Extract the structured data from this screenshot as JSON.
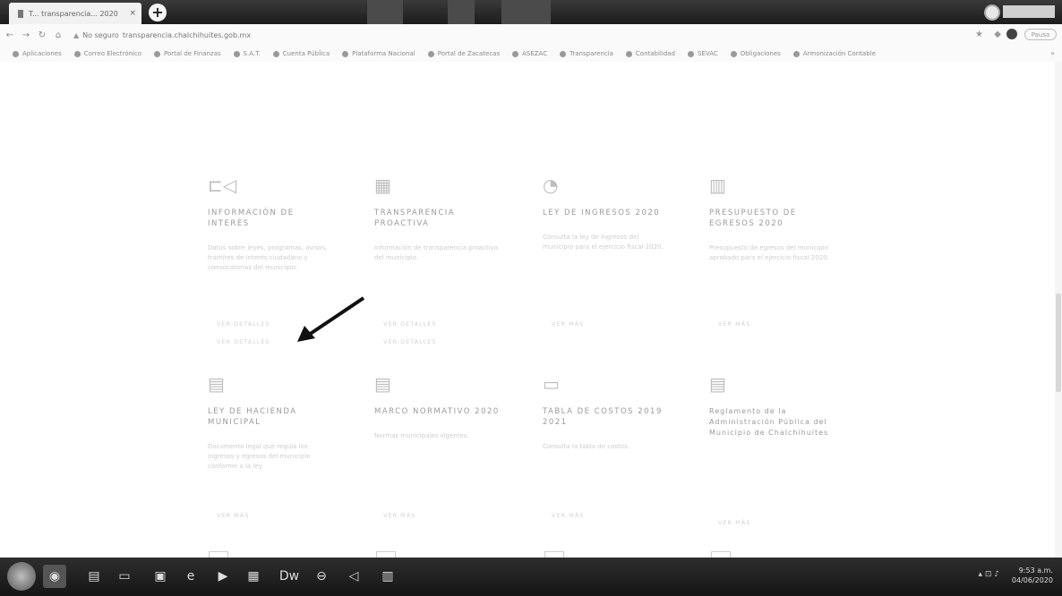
{
  "browser": {
    "tab_title": "T... transparencia... 2020",
    "tab_close": "×",
    "new_tab": "+",
    "url": "transparencia.chalchihuites.gob.mx",
    "secure_label": "No seguro",
    "paused_label": "Pausa",
    "bookmarks_more": "»",
    "bookmarks": [
      "Aplicaciones",
      "Correo Electrónico",
      "Portal de Finanzas",
      "S.A.T.",
      "Cuenta Pública",
      "Plataforma Nacional",
      "Portal de Zacatecas",
      "ASEZAC",
      "Transparencia",
      "Contabilidad",
      "SEVAC",
      "Obligaciones",
      "Armonización Contable"
    ]
  },
  "cards": [
    {
      "icon": "megaphone-icon",
      "title": "INFORMACIÓN DE INTERÉS",
      "desc": "Datos sobre leyes, programas, avisos, trámites de interés ciudadano y convocatorias del municipio.",
      "link": "VER DETALLES",
      "link2": "VER DETALLES"
    },
    {
      "icon": "calendar-icon",
      "title": "TRANSPARENCIA PROACTIVA",
      "desc": "Información de transparencia proactiva del municipio.",
      "link": "VER DETALLES",
      "link2": "VER DETALLES"
    },
    {
      "icon": "pie-chart-icon",
      "title": "LEY DE INGRESOS 2020",
      "desc": "Consulta la ley de ingresos del municipio para el ejercicio fiscal 2020.",
      "link": "VER MÁS",
      "link2": ""
    },
    {
      "icon": "bar-chart-icon",
      "title": "PRESUPUESTO DE EGRESOS 2020",
      "desc": "Presupuesto de egresos del municipio aprobado para el ejercicio fiscal 2020.",
      "link": "VER MÁS",
      "link2": ""
    },
    {
      "icon": "book-icon",
      "title": "LEY DE HACIENDA MUNICIPAL",
      "desc": "Documento legal que regula los ingresos y egresos del municipio conforme a la ley.",
      "link": "VER MÁS",
      "link2": ""
    },
    {
      "icon": "document-icon",
      "title": "MARCO NORMATIVO 2020",
      "desc": "Normas municipales vigentes.",
      "link": "VER MÁS",
      "link2": ""
    },
    {
      "icon": "folder-icon",
      "title": "TABLA DE COSTOS 2019 2021",
      "desc": "Consulta la tabla de costos.",
      "link": "VER MÁS",
      "link2": ""
    },
    {
      "icon": "document-icon",
      "title": "Reglamento de la Administración Pública del Municipio de Chalchihuites",
      "desc": "",
      "link": "VER MÁS",
      "link2": ""
    }
  ],
  "taskbar": {
    "clock_time": "9:53 a.m.",
    "clock_date": "04/06/2020"
  }
}
